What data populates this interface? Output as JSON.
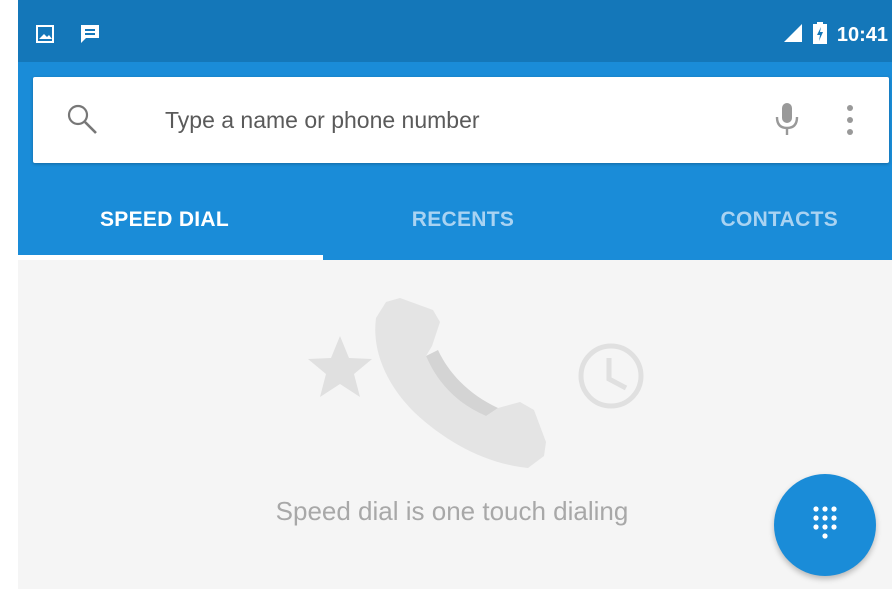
{
  "status_bar": {
    "time": "10:41",
    "left_icons": [
      "image-notification-icon",
      "message-notification-icon"
    ],
    "right_icons": [
      "signal-icon",
      "battery-charging-icon"
    ]
  },
  "search": {
    "placeholder": "Type a name or phone number",
    "value": ""
  },
  "tabs": [
    {
      "label": "SPEED DIAL",
      "active": true
    },
    {
      "label": "RECENTS",
      "active": false
    },
    {
      "label": "CONTACTS",
      "active": false
    }
  ],
  "empty_state": {
    "message": "Speed dial is one touch dialing",
    "illustration_icons": [
      "star-icon",
      "phone-handset-icon",
      "clock-icon"
    ]
  },
  "fab": {
    "icon": "dialpad-icon"
  },
  "colors": {
    "status_bar": "#1477b9",
    "app_bar": "#1a8cd8",
    "inactive_tab": "#a9d3f2",
    "background": "#f5f5f5",
    "illustration": "#e2e2e2"
  }
}
